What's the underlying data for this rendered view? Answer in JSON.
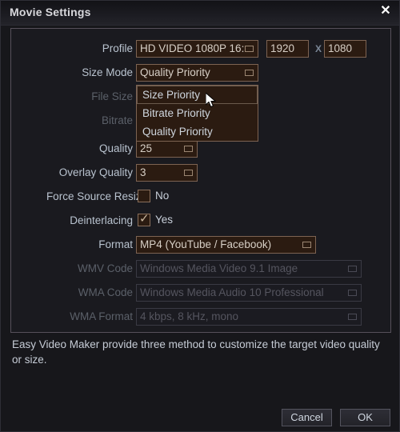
{
  "window": {
    "title": "Movie Settings",
    "close_icon": "close-icon",
    "close_glyph": "✕"
  },
  "form": {
    "profile": {
      "label": "Profile",
      "value": "HD VIDEO 1080P 16:",
      "width": "1920",
      "separator": "X",
      "height": "1080"
    },
    "size_mode": {
      "label": "Size Mode",
      "value": "Quality Priority",
      "options": [
        "Size Priority",
        "Bitrate Priority",
        "Quality Priority"
      ],
      "hovered_option": "Size Priority",
      "expanded": true
    },
    "file_size": {
      "label": "File Size",
      "value": "",
      "disabled": true
    },
    "bitrate": {
      "label": "Bitrate",
      "value": "",
      "disabled": true
    },
    "quality": {
      "label": "Quality",
      "value": "25"
    },
    "overlay_quality": {
      "label": "Overlay Quality",
      "value": "3"
    },
    "force_source_resize": {
      "label": "Force Source Resize",
      "value": "No",
      "checked": false
    },
    "deinterlacing": {
      "label": "Deinterlacing",
      "value": "Yes",
      "checked": true,
      "check_glyph": "✓"
    },
    "format": {
      "label": "Format",
      "value": "MP4 (YouTube / Facebook)"
    },
    "wmv_code": {
      "label": "WMV Code",
      "value": "Windows Media Video 9.1 Image",
      "disabled": true
    },
    "wma_code": {
      "label": "WMA Code",
      "value": "Windows Media Audio 10 Professional",
      "disabled": true
    },
    "wma_format": {
      "label": "WMA Format",
      "value": "4 kbps, 8 kHz, mono",
      "disabled": true
    }
  },
  "hint": {
    "text": "Easy Video Maker provide three method to customize the target video quality or size."
  },
  "footer": {
    "cancel_label": "Cancel",
    "ok_label": "OK"
  },
  "colors": {
    "window_bg": "#17171b",
    "field_bg": "#2b1b11",
    "field_border": "#7d6352",
    "label": "#b9c3cf",
    "label_disabled": "#5b6069",
    "accent_text": "#d7cfc6"
  }
}
